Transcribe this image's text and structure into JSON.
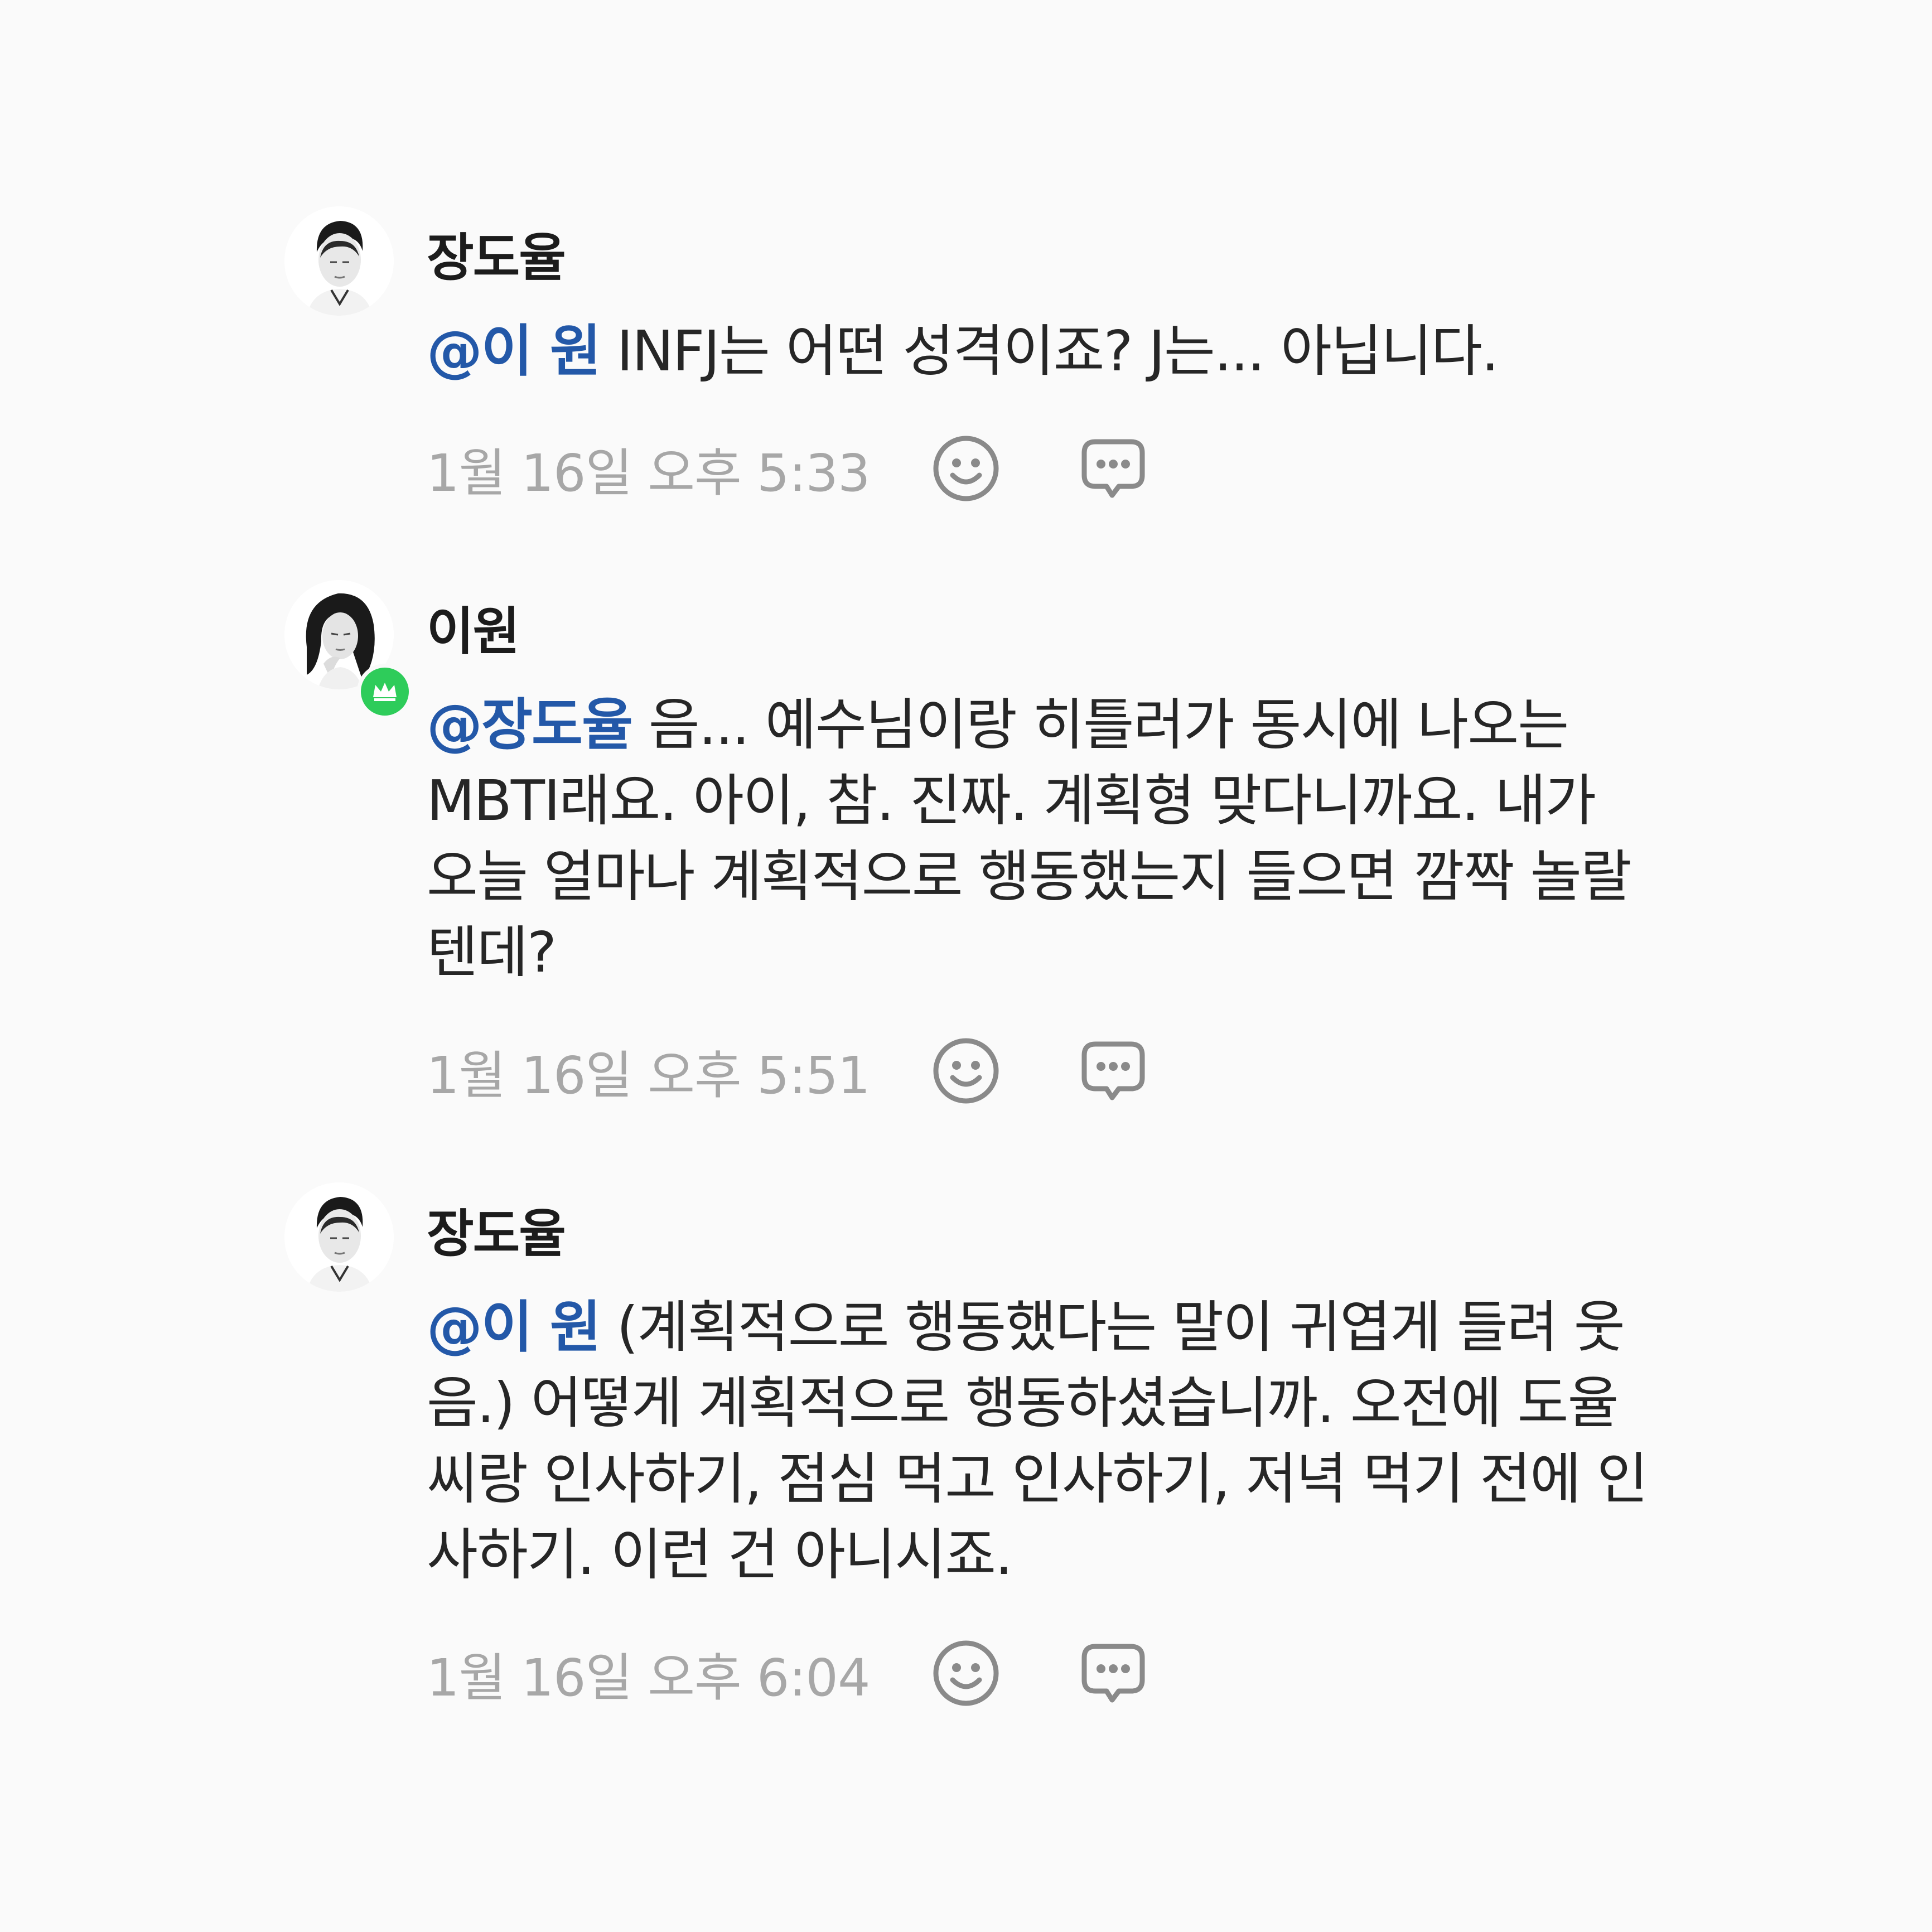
{
  "comments": [
    {
      "author": "장도율",
      "mention": "@이 원",
      "text": " INFJ는 어떤 성격이죠? J는... 아닙니다.",
      "time": "1월 16일 오후 5:33",
      "avatar_icon": "male-portrait-avatar",
      "badge": null
    },
    {
      "author": "이원",
      "mention": "@장도율",
      "text": " 음... 예수님이랑 히틀러가 동시에 나오는 MBTI래요. 아이, 참. 진짜. 계획형 맞다니까요. 내가 오늘 얼마나 계획적으로 행동했는지 들으면 깜짝 놀랄 텐데?",
      "time": "1월 16일 오후 5:51",
      "avatar_icon": "female-portrait-avatar",
      "badge": "crown-icon"
    },
    {
      "author": "장도율",
      "mention": "@이 원",
      "text": " (계획적으로 행동했다는 말이 귀엽게 들려 웃음.) 어떻게 계획적으로 행동하셨습니까. 오전에 도율 씨랑 인사하기, 점심 먹고 인사하기, 저녁 먹기 전에 인사하기. 이런 건 아니시죠.",
      "time": "1월 16일 오후 6:04",
      "avatar_icon": "male-portrait-avatar",
      "badge": null
    }
  ],
  "colors": {
    "background": "#fafafa",
    "mention": "#2358a8",
    "timestamp": "#a7a7a7",
    "badge": "#2ecc5a"
  },
  "icons": {
    "reaction": "smiley-face-icon",
    "reply": "speech-bubble-dots-icon"
  }
}
